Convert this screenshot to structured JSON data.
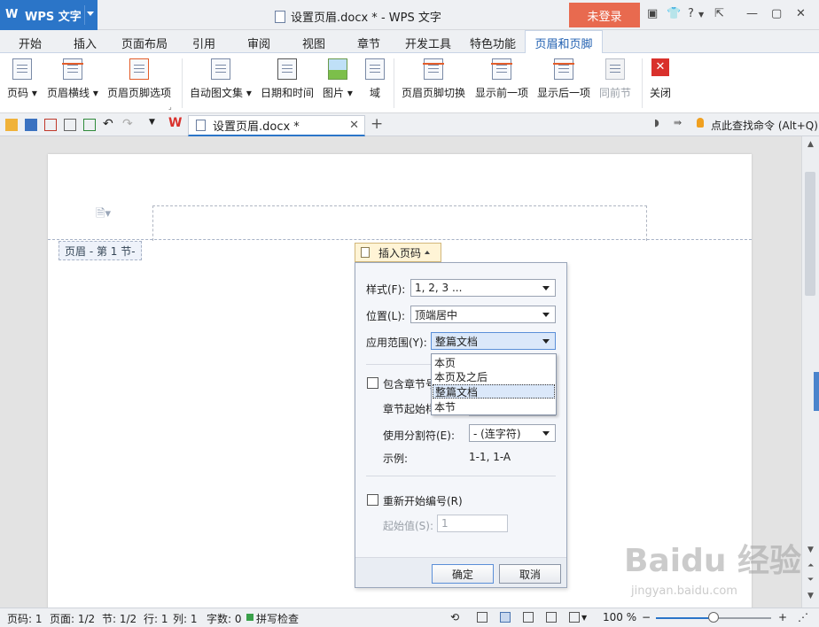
{
  "titlebar": {
    "app_name": "WPS 文字",
    "window_title": "设置页眉.docx * - WPS 文字",
    "login": "未登录",
    "help": "?"
  },
  "tabs": [
    "开始",
    "插入",
    "页面布局",
    "引用",
    "审阅",
    "视图",
    "章节",
    "开发工具",
    "特色功能",
    "页眉和页脚"
  ],
  "ribbon": {
    "page_number": "页码",
    "header_line": "页眉横线",
    "header_footer_options": "页眉页脚选项",
    "auto_text": "自动图文集",
    "date_time": "日期和时间",
    "picture": "图片",
    "field": "域",
    "switch": "页眉页脚切换",
    "show_prev": "显示前一项",
    "show_next": "显示后一项",
    "same_as_prev": "同前节",
    "close": "关闭"
  },
  "quickbar": {
    "doc_tab": "设置页眉.docx *",
    "find_command": "点此查找命令 (Alt+Q)"
  },
  "document": {
    "header_tag": "页眉  - 第 1 节-",
    "insert_page_number": "插入页码"
  },
  "dialog": {
    "style_label": "样式(F):",
    "style_value": "1, 2, 3 ...",
    "position_label": "位置(L):",
    "position_value": "顶端居中",
    "scope_label": "应用范围(Y):",
    "scope_value": "整篇文档",
    "scope_options": [
      "本页",
      "本页及之后",
      "整篇文档",
      "本节"
    ],
    "include_chapter": "包含章节号",
    "chapter_start_style": "章节起始样",
    "separator_label": "使用分割符(E):",
    "separator_value": "-  (连字符)",
    "example_label": "示例:",
    "example_value": "1-1, 1-A",
    "restart_numbering": "重新开始编号(R)",
    "start_value_label": "起始值(S):",
    "start_value": "1",
    "ok": "确定",
    "cancel": "取消"
  },
  "statusbar": {
    "page": "页码: 1",
    "pages": "页面: 1/2",
    "section": "节: 1/2",
    "row": "行: 1",
    "column": "列: 1",
    "word_count": "字数: 0",
    "spell_check": "拼写检查",
    "zoom": "100 %",
    "zoom_level": 0.5,
    "minus": "−",
    "plus": "+"
  },
  "watermark": {
    "text": "Baidu 经验",
    "url": "jingyan.baidu.com"
  },
  "colors": {
    "accent": "#2b75c8",
    "login": "#e86a4f",
    "close_red": "#d9312c"
  }
}
